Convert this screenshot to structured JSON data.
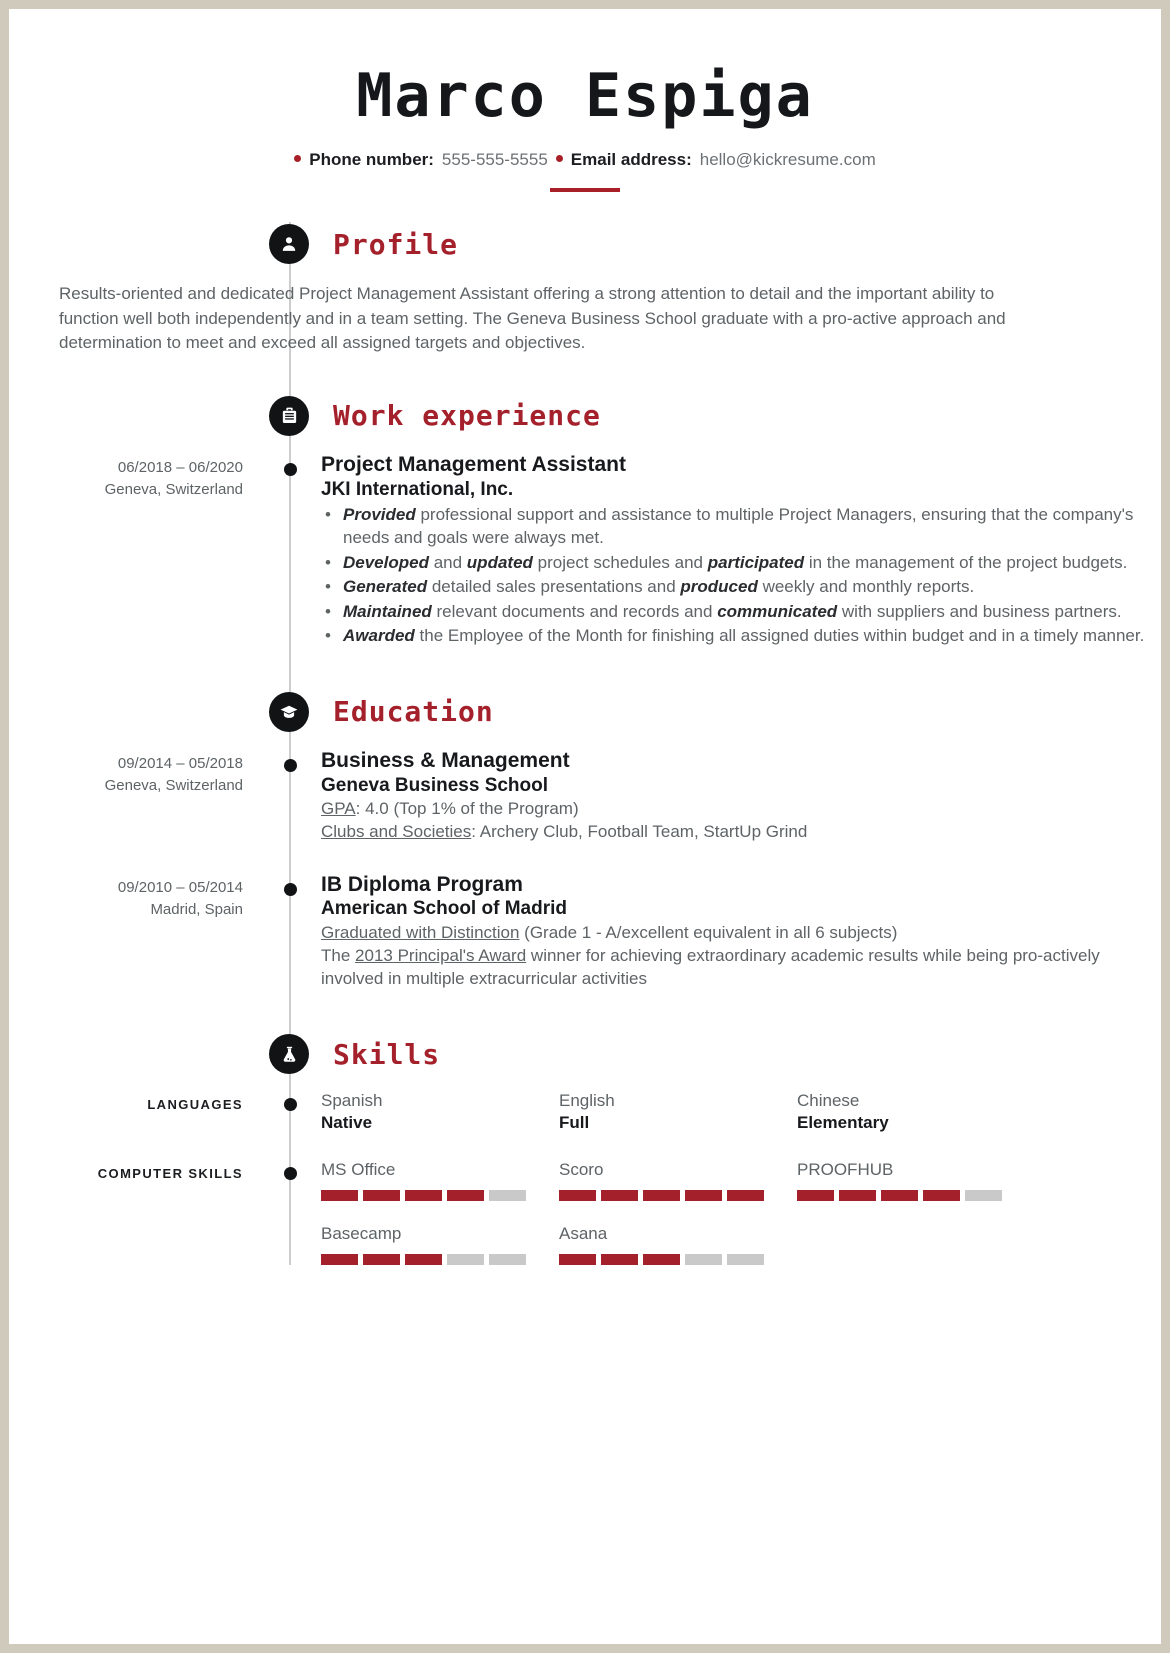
{
  "header": {
    "name": "Marco Espiga",
    "contacts": [
      {
        "label": "Phone number:",
        "value": "555-555-5555"
      },
      {
        "label": "Email address:",
        "value": "hello@kickresume.com"
      }
    ]
  },
  "accent_color": "#a4202b",
  "sections": {
    "profile": {
      "title": "Profile",
      "icon": "person-icon",
      "text": "Results-oriented and dedicated Project Management Assistant offering a strong attention to detail and the important ability to function well both independently and in a team setting. The Geneva Business School graduate with a pro-active approach and determination to meet and exceed all assigned targets and objectives."
    },
    "work": {
      "title": "Work experience",
      "icon": "briefcase-icon",
      "entries": [
        {
          "dates": "06/2018 – 06/2020",
          "location": "Geneva, Switzerland",
          "title": "Project Management Assistant",
          "org": "JKI International, Inc.",
          "bullets": [
            [
              {
                "t": "Provided",
                "b": true
              },
              {
                "t": " professional support and assistance to multiple Project Managers, ensuring that the company's needs and goals were always met.",
                "b": false
              }
            ],
            [
              {
                "t": "Developed",
                "b": true
              },
              {
                "t": " and ",
                "b": false
              },
              {
                "t": "updated",
                "b": true
              },
              {
                "t": " project schedules and ",
                "b": false
              },
              {
                "t": "participated",
                "b": true
              },
              {
                "t": " in the management of the project budgets.",
                "b": false
              }
            ],
            [
              {
                "t": "Generated",
                "b": true
              },
              {
                "t": " detailed sales presentations and ",
                "b": false
              },
              {
                "t": "produced",
                "b": true
              },
              {
                "t": " weekly and monthly reports.",
                "b": false
              }
            ],
            [
              {
                "t": "Maintained",
                "b": true
              },
              {
                "t": " relevant documents and records and ",
                "b": false
              },
              {
                "t": "communicated",
                "b": true
              },
              {
                "t": " with suppliers and business partners.",
                "b": false
              }
            ],
            [
              {
                "t": "Awarded",
                "b": true
              },
              {
                "t": " the Employee of the Month for finishing all assigned duties within budget and in a timely manner.",
                "b": false
              }
            ]
          ]
        }
      ]
    },
    "education": {
      "title": "Education",
      "icon": "graduation-cap-icon",
      "entries": [
        {
          "dates": "09/2014 – 05/2018",
          "location": "Geneva, Switzerland",
          "title": "Business & Management",
          "org": "Geneva Business School",
          "lines": [
            [
              {
                "t": "GPA",
                "u": true
              },
              {
                "t": ": 4.0 (Top 1% of the Program)",
                "u": false
              }
            ],
            [
              {
                "t": "Clubs and Societies",
                "u": true
              },
              {
                "t": ": Archery Club, Football Team, StartUp Grind",
                "u": false
              }
            ]
          ]
        },
        {
          "dates": "09/2010 – 05/2014",
          "location": "Madrid, Spain",
          "title": "IB Diploma Program",
          "org": "American School of Madrid",
          "lines": [
            [
              {
                "t": "Graduated with Distinction",
                "u": true
              },
              {
                "t": " (Grade 1 - A/excellent equivalent in all 6 subjects)",
                "u": false
              }
            ],
            [
              {
                "t": "The ",
                "u": false
              },
              {
                "t": "2013 Principal's Award",
                "u": true
              },
              {
                "t": " winner for achieving extraordinary academic results while being pro-actively involved in multiple extracurricular activities",
                "u": false
              }
            ]
          ]
        }
      ]
    },
    "skills": {
      "title": "Skills",
      "icon": "flask-icon",
      "groups": [
        {
          "label": "LANGUAGES",
          "type": "levels",
          "items": [
            {
              "name": "Spanish",
              "level": "Native"
            },
            {
              "name": "English",
              "level": "Full"
            },
            {
              "name": "Chinese",
              "level": "Elementary"
            }
          ]
        },
        {
          "label": "COMPUTER SKILLS",
          "type": "bars",
          "max": 5,
          "rows": [
            [
              {
                "name": "MS Office",
                "value": 4
              },
              {
                "name": "Scoro",
                "value": 5
              },
              {
                "name": "PROOFHUB",
                "value": 4
              }
            ],
            [
              {
                "name": "Basecamp",
                "value": 3
              },
              {
                "name": "Asana",
                "value": 3
              }
            ]
          ]
        }
      ]
    }
  }
}
